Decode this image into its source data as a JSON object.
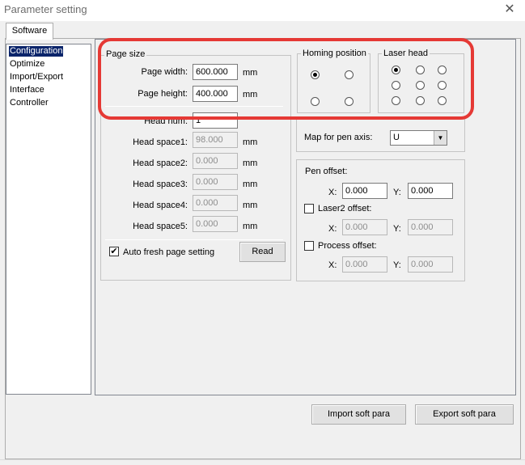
{
  "window": {
    "title": "Parameter setting",
    "close_glyph": "✕"
  },
  "tabs": [
    {
      "label": "Software"
    }
  ],
  "tree": {
    "items": [
      {
        "label": "Configuration",
        "selected": true
      },
      {
        "label": "Optimize"
      },
      {
        "label": "Import/Export"
      },
      {
        "label": "Interface"
      },
      {
        "label": "Controller"
      }
    ]
  },
  "page_size": {
    "legend": "Page size",
    "width_label": "Page width:",
    "width_value": "600.000",
    "height_label": "Page height:",
    "height_value": "400.000",
    "unit": "mm"
  },
  "heads": {
    "head_num_label": "Head num:",
    "head_num_value": "1",
    "rows": [
      {
        "label": "Head space1:",
        "value": "98.000",
        "unit": "mm"
      },
      {
        "label": "Head space2:",
        "value": "0.000",
        "unit": "mm"
      },
      {
        "label": "Head space3:",
        "value": "0.000",
        "unit": "mm"
      },
      {
        "label": "Head space4:",
        "value": "0.000",
        "unit": "mm"
      },
      {
        "label": "Head space5:",
        "value": "0.000",
        "unit": "mm"
      }
    ],
    "auto_fresh_label": "Auto fresh page setting",
    "auto_fresh_checked": true,
    "read_button": "Read"
  },
  "homing": {
    "legend": "Homing position",
    "selected_index": 0
  },
  "laser_head": {
    "legend": "Laser head",
    "selected_index": 0
  },
  "pen_axis": {
    "label": "Map for pen axis:",
    "value": "U"
  },
  "offsets": {
    "pen_offset_label": "Pen offset:",
    "pen_x": "0.000",
    "pen_y": "0.000",
    "laser2_label": "Laser2 offset:",
    "laser2_x": "0.000",
    "laser2_y": "0.000",
    "process_label": "Process offset:",
    "process_x": "0.000",
    "process_y": "0.000",
    "x_label": "X:",
    "y_label": "Y:"
  },
  "footer": {
    "import_button": "Import soft para",
    "export_button": "Export soft para"
  },
  "colors": {
    "highlight": "#e53935",
    "selection": "#0a246a"
  }
}
